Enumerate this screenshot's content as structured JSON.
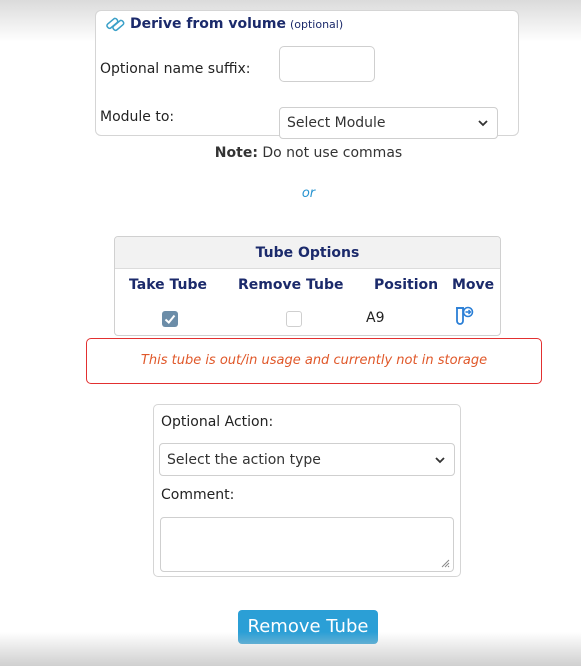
{
  "derive": {
    "title": "Derive from volume",
    "title_optional": "(optional)",
    "icon": "derive-tubes-icon",
    "suffix_label": "Optional name suffix:",
    "suffix_value": "",
    "module_label": "Module to:",
    "module_selected": "Select Module"
  },
  "note": {
    "bold": "Note:",
    "text": " Do not use commas"
  },
  "or_text": "or",
  "tube_options": {
    "title": "Tube Options",
    "headers": {
      "take": "Take Tube",
      "remove": "Remove Tube",
      "position": "Position",
      "move": "Move"
    },
    "row": {
      "take_checked": true,
      "remove_checked": false,
      "position": "A9",
      "move_icon": "move-tube-icon"
    }
  },
  "warning": "This tube is out/in usage and currently not in storage",
  "action": {
    "optional_label": "Optional Action:",
    "action_selected": "Select the action type",
    "comment_label": "Comment:",
    "comment_value": ""
  },
  "submit_label": "Remove Tube",
  "colors": {
    "navy": "#1b2a6b",
    "accent": "#2b9fd6",
    "warning_border": "#e23030",
    "warning_text": "#e0582a"
  }
}
